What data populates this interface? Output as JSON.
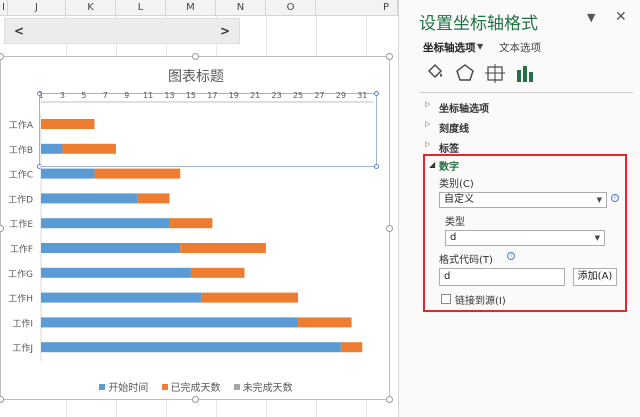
{
  "sheet": {
    "columns": [
      "I",
      "J",
      "K",
      "L",
      "M",
      "N",
      "O",
      "P"
    ],
    "nav": {
      "prev": "<",
      "next": ">"
    }
  },
  "chart": {
    "title": "图表标题",
    "legend": [
      "开始时间",
      "已完成天数",
      "未完成天数"
    ]
  },
  "chart_data": {
    "type": "bar",
    "orientation": "horizontal-stacked",
    "title": "图表标题",
    "categories": [
      "工作A",
      "工作B",
      "工作C",
      "工作D",
      "工作E",
      "工作F",
      "工作G",
      "工作H",
      "工作I",
      "工作J"
    ],
    "x_ticks": [
      "1",
      "3",
      "5",
      "7",
      "9",
      "11",
      "13",
      "15",
      "17",
      "19",
      "21",
      "23",
      "25",
      "27",
      "29",
      "31"
    ],
    "xlim": [
      1,
      31
    ],
    "series": [
      {
        "name": "开始时间",
        "color": "#5b9bd5",
        "values": [
          0,
          2,
          5,
          9,
          12,
          13,
          14,
          15,
          24,
          28
        ]
      },
      {
        "name": "已完成天数",
        "color": "#ed7d31",
        "values": [
          5,
          5,
          8,
          3,
          4,
          8,
          5,
          9,
          5,
          2
        ]
      },
      {
        "name": "未完成天数",
        "color": "#a5a5a5",
        "values": [
          0,
          0,
          0,
          0,
          0,
          0,
          0,
          0,
          0,
          0
        ]
      }
    ],
    "legend_position": "bottom"
  },
  "pane": {
    "title": "设置坐标轴格式",
    "tab_axis": "坐标轴选项",
    "tab_text": "文本选项",
    "sections": [
      "坐标轴选项",
      "刻度线",
      "标签"
    ],
    "number": {
      "title": "数字",
      "category_label": "类别(C)",
      "category_value": "自定义",
      "type_label": "类型",
      "type_value": "d",
      "format_code_label": "格式代码(T)",
      "format_code_value": "d",
      "add_button": "添加(A)",
      "link_label": "链接到源(I)"
    },
    "icons": [
      "paint-bucket-icon",
      "pentagon-icon",
      "size-properties-icon",
      "bar-chart-icon"
    ],
    "accent_color": "#217346",
    "highlight_color": "#e2262d"
  }
}
